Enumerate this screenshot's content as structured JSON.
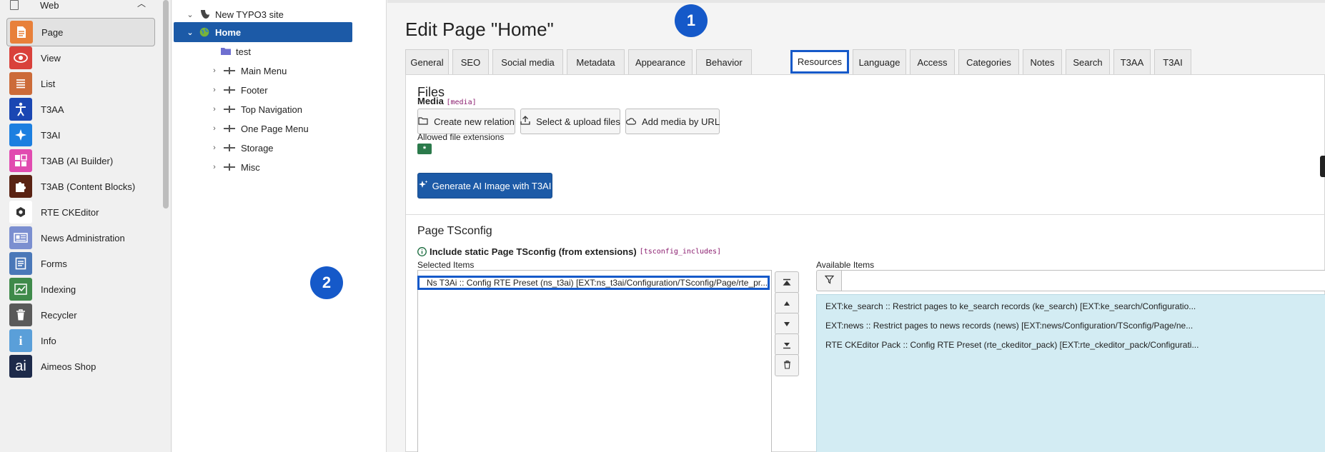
{
  "module_menu": {
    "group_label": "Web",
    "items": [
      {
        "label": "Page",
        "color": "#e8803a",
        "active": true
      },
      {
        "label": "View",
        "color": "#d9413b"
      },
      {
        "label": "List",
        "color": "#cc6b39"
      },
      {
        "label": "T3AA",
        "color": "#1a47b3"
      },
      {
        "label": "T3AI",
        "color": "#1c7fe0"
      },
      {
        "label": "T3AB (AI Builder)",
        "color": "#e14bb0"
      },
      {
        "label": "T3AB (Content Blocks)",
        "color": "#5a2313"
      },
      {
        "label": "RTE CKEditor",
        "color": "#ffffff"
      },
      {
        "label": "News Administration",
        "color": "#7b8fd0"
      },
      {
        "label": "Forms",
        "color": "#4a78b8"
      },
      {
        "label": "Indexing",
        "color": "#3f8a4a"
      },
      {
        "label": "Recycler",
        "color": "#5a5a5a"
      },
      {
        "label": "Info",
        "color": "#5a9fd9"
      },
      {
        "label": "Aimeos Shop",
        "color": "#1d2a4a"
      }
    ],
    "icon_names": [
      "page-icon",
      "view-icon",
      "list-icon",
      "t3aa-icon",
      "t3ai-icon",
      "t3ab-ai-builder-icon",
      "t3ab-content-blocks-icon",
      "rte-ckeditor-icon",
      "news-icon",
      "forms-icon",
      "indexing-icon",
      "recycler-icon",
      "info-icon",
      "aimeos-icon"
    ]
  },
  "page_tree": {
    "root": "New TYPO3 site",
    "home": "Home",
    "nodes": [
      {
        "label": "test",
        "kind": "folder"
      },
      {
        "label": "Main Menu",
        "kind": "separator"
      },
      {
        "label": "Footer",
        "kind": "separator"
      },
      {
        "label": "Top Navigation",
        "kind": "separator"
      },
      {
        "label": "One Page Menu",
        "kind": "separator"
      },
      {
        "label": "Storage",
        "kind": "separator"
      },
      {
        "label": "Misc",
        "kind": "separator"
      }
    ]
  },
  "main": {
    "title": "Edit Page \"Home\"",
    "tabs": [
      "General",
      "SEO",
      "Social media",
      "Metadata",
      "Appearance",
      "Behavior",
      "Resources",
      "Language",
      "Access",
      "Categories",
      "Notes",
      "Search",
      "T3AA",
      "T3AI"
    ],
    "active_tab": "Resources",
    "files": {
      "section_title": "Files",
      "media_label": "Media",
      "media_code": "[media]",
      "buttons": [
        "Create new relation",
        "Select & upload files",
        "Add media by URL"
      ],
      "allowed_label": "Allowed file extensions",
      "allowed_value": "*",
      "generate_button": "Generate AI Image with T3AI"
    },
    "tsconfig": {
      "section_title": "Page TSconfig",
      "include_label": "Include static Page TSconfig (from extensions)",
      "include_code": "[tsconfig_includes]",
      "selected_label": "Selected Items",
      "selected_items": [
        "Ns T3Ai :: Config RTE Preset (ns_t3ai) [EXT:ns_t3ai/Configuration/TSconfig/Page/rte_pr..."
      ],
      "available_label": "Available Items",
      "filter_placeholder": "",
      "available_items": [
        "EXT:ke_search :: Restrict pages to ke_search records (ke_search) [EXT:ke_search/Configuratio...",
        "EXT:news :: Restrict pages to news records (news) [EXT:news/Configuration/TSconfig/Page/ne...",
        "RTE CKEditor Pack :: Config RTE Preset (rte_ckeditor_pack) [EXT:rte_ckeditor_pack/Configurati..."
      ]
    },
    "callouts": [
      "1",
      "2"
    ]
  },
  "colors": {
    "accent": "#1559c9",
    "tree_selected": "#1c5aa7",
    "available_bg": "#d3ecf3"
  }
}
